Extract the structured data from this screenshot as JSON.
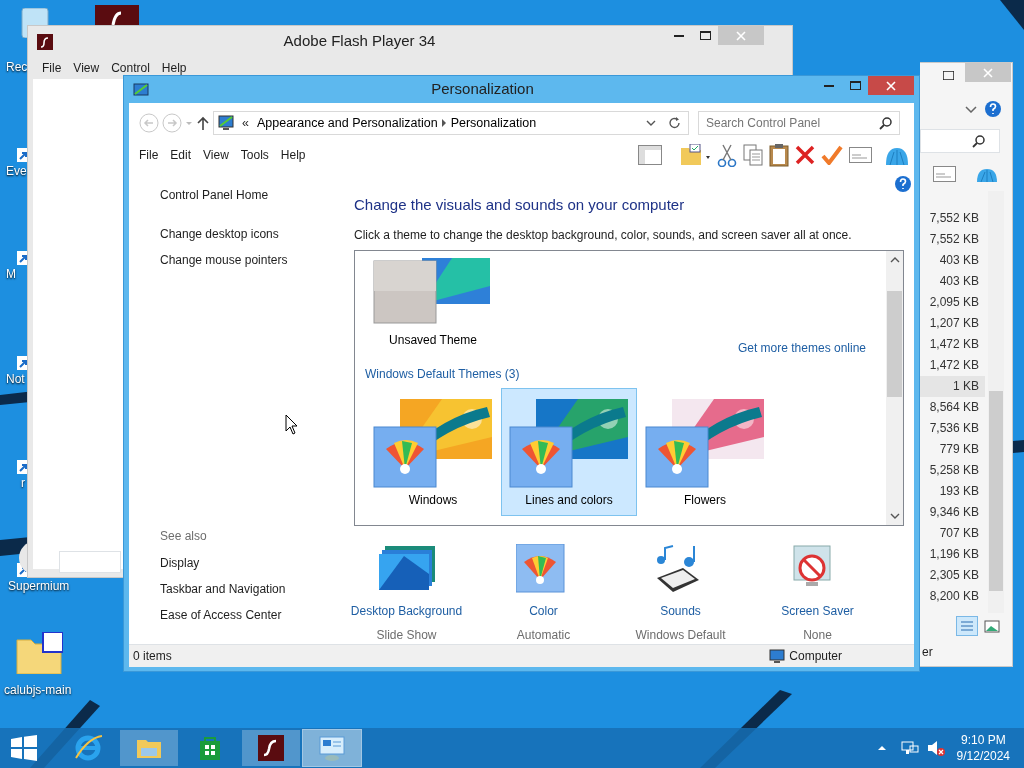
{
  "desktop_icons": [
    {
      "kind": "recycle",
      "label": "Rec"
    },
    {
      "kind": "shortcut",
      "label": "Eve"
    },
    {
      "kind": "shortcut",
      "label": "M"
    },
    {
      "kind": "shortcut",
      "label": "Not"
    },
    {
      "kind": "shortcut",
      "label": "r"
    },
    {
      "kind": "shortcut",
      "label": "Supermium"
    },
    {
      "kind": "folder",
      "label": "calubjs-main"
    }
  ],
  "flash_window": {
    "title": "Adobe Flash Player 34",
    "menu": [
      "File",
      "View",
      "Control",
      "Help"
    ]
  },
  "back_window": {
    "sizes": [
      {
        "text": "7,552 KB",
        "selected": false
      },
      {
        "text": "7,552 KB",
        "selected": false
      },
      {
        "text": "403 KB",
        "selected": false
      },
      {
        "text": "403 KB",
        "selected": false
      },
      {
        "text": "2,095 KB",
        "selected": false
      },
      {
        "text": "1,207 KB",
        "selected": false
      },
      {
        "text": "1,472 KB",
        "selected": false
      },
      {
        "text": "1,472 KB",
        "selected": false
      },
      {
        "text": "1 KB",
        "selected": true
      },
      {
        "text": "8,564 KB",
        "selected": false
      },
      {
        "text": "7,536 KB",
        "selected": false
      },
      {
        "text": "779 KB",
        "selected": false
      },
      {
        "text": "5,258 KB",
        "selected": false
      },
      {
        "text": "193 KB",
        "selected": false
      },
      {
        "text": "9,346 KB",
        "selected": false
      },
      {
        "text": "707 KB",
        "selected": false
      },
      {
        "text": "1,196 KB",
        "selected": false
      },
      {
        "text": "2,305 KB",
        "selected": false
      },
      {
        "text": "8,200 KB",
        "selected": false
      }
    ],
    "status": "er"
  },
  "window": {
    "title": "Personalization",
    "breadcrumb_prefix": "«",
    "breadcrumb": [
      "Appearance and Personalization",
      "Personalization"
    ],
    "search": {
      "placeholder": "Search Control Panel"
    },
    "menu": [
      "File",
      "Edit",
      "View",
      "Tools",
      "Help"
    ],
    "sidebar": {
      "links": [
        "Control Panel Home",
        "Change desktop icons",
        "Change mouse pointers"
      ],
      "see_also_title": "See also",
      "see_also": [
        "Display",
        "Taskbar and Navigation",
        "Ease of Access Center"
      ]
    },
    "heading": "Change the visuals and sounds on your computer",
    "instruction": "Click a theme to change the desktop background, color, sounds, and screen saver all at once.",
    "my_themes": [
      {
        "kind": "unsaved",
        "name": "Unsaved Theme",
        "selected": false
      }
    ],
    "more_link": "Get more themes online",
    "group_title": "Windows Default Themes (3)",
    "themes": [
      {
        "kind": "windows",
        "name": "Windows",
        "selected": false
      },
      {
        "kind": "lines",
        "name": "Lines and colors",
        "selected": true
      },
      {
        "kind": "flowers",
        "name": "Flowers",
        "selected": false
      }
    ],
    "settings": [
      {
        "kind": "background",
        "label": "Desktop Background",
        "value": "Slide Show"
      },
      {
        "kind": "color",
        "label": "Color",
        "value": "Automatic"
      },
      {
        "kind": "sounds",
        "label": "Sounds",
        "value": "Windows Default"
      },
      {
        "kind": "saver",
        "label": "Screen Saver",
        "value": "None"
      }
    ],
    "status_bar": {
      "items": "0 items",
      "location": "Computer"
    }
  },
  "taskbar": {
    "apps": [
      {
        "kind": "ie",
        "open": false,
        "selected": false
      },
      {
        "kind": "explorer",
        "open": true,
        "selected": false
      },
      {
        "kind": "store",
        "open": false,
        "selected": false
      },
      {
        "kind": "flash",
        "open": true,
        "selected": false
      },
      {
        "kind": "control",
        "open": true,
        "selected": true
      }
    ],
    "time": "9:10 PM",
    "date": "9/12/2024"
  }
}
